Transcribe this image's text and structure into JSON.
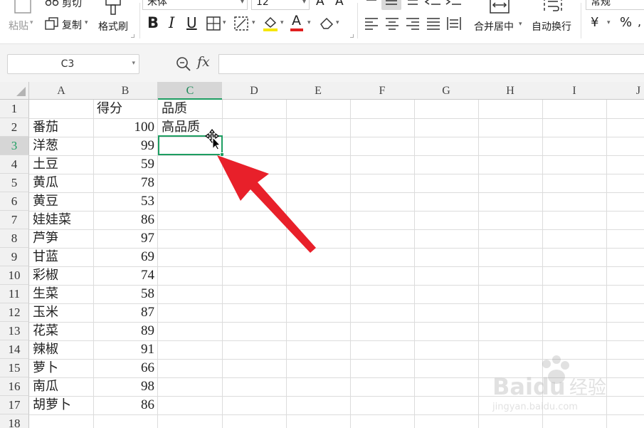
{
  "ribbon": {
    "paste_label": "粘贴",
    "cut_label": "剪切",
    "copy_label": "复制",
    "format_painter_label": "格式刷",
    "font_name": "宋体",
    "font_size": "12",
    "bold": "B",
    "italic": "I",
    "underline": "U",
    "font_color_glyph": "A",
    "merge_center_label": "合并居中",
    "wrap_text_label": "自动换行",
    "number_format": "常规",
    "currency_glyph": "¥",
    "percent_glyph": "%"
  },
  "formula_bar": {
    "name_box": "C3",
    "fx_label": "fx",
    "formula": ""
  },
  "sheet": {
    "columns": [
      "A",
      "B",
      "C",
      "D",
      "E",
      "F",
      "G",
      "H",
      "I",
      "J"
    ],
    "selected_column": "C",
    "selected_row": 3,
    "rows": [
      {
        "num": "1",
        "a": "",
        "b": "得分",
        "c": "品质"
      },
      {
        "num": "2",
        "a": "番茄",
        "b": "100",
        "c": "高品质"
      },
      {
        "num": "3",
        "a": "洋葱",
        "b": "99",
        "c": ""
      },
      {
        "num": "4",
        "a": "土豆",
        "b": "59",
        "c": ""
      },
      {
        "num": "5",
        "a": "黄瓜",
        "b": "78",
        "c": ""
      },
      {
        "num": "6",
        "a": "黄豆",
        "b": "53",
        "c": ""
      },
      {
        "num": "7",
        "a": "娃娃菜",
        "b": "86",
        "c": ""
      },
      {
        "num": "8",
        "a": "芦笋",
        "b": "97",
        "c": ""
      },
      {
        "num": "9",
        "a": "甘蓝",
        "b": "69",
        "c": ""
      },
      {
        "num": "10",
        "a": "彩椒",
        "b": "74",
        "c": ""
      },
      {
        "num": "11",
        "a": "生菜",
        "b": "58",
        "c": ""
      },
      {
        "num": "12",
        "a": "玉米",
        "b": "87",
        "c": ""
      },
      {
        "num": "13",
        "a": "花菜",
        "b": "89",
        "c": ""
      },
      {
        "num": "14",
        "a": "辣椒",
        "b": "91",
        "c": ""
      },
      {
        "num": "15",
        "a": "萝卜",
        "b": "66",
        "c": ""
      },
      {
        "num": "16",
        "a": "南瓜",
        "b": "98",
        "c": ""
      },
      {
        "num": "17",
        "a": "胡萝卜",
        "b": "86",
        "c": ""
      },
      {
        "num": "18",
        "a": "",
        "b": "",
        "c": ""
      }
    ]
  },
  "colors": {
    "selection": "#1e9e62",
    "arrow": "#e8202a",
    "header_bg": "#f1f1f1"
  },
  "watermark": {
    "brand": "Baidu",
    "product": "经验",
    "url": "jingyan.baidu.com"
  }
}
